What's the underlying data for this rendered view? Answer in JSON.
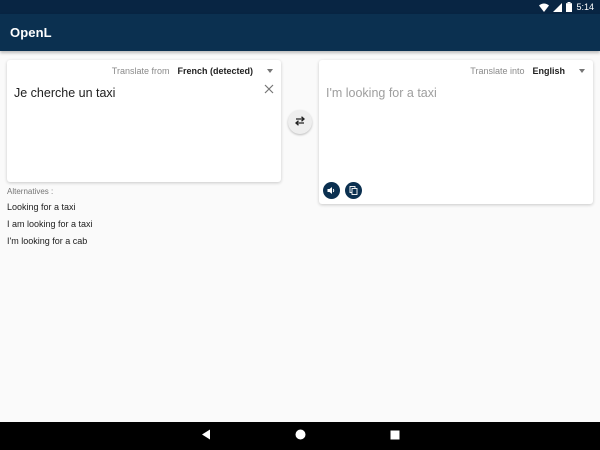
{
  "status_bar": {
    "time": "5:14"
  },
  "app_bar": {
    "title": "OpenL"
  },
  "source": {
    "caption": "Translate from",
    "language": "French (detected)",
    "text": "Je cherche un taxi"
  },
  "target": {
    "caption": "Translate into",
    "language": "English",
    "text": "I'm looking for a taxi"
  },
  "alternatives": {
    "caption": "Alternatives :",
    "items": [
      "Looking for a taxi",
      "I am looking for a taxi",
      "I'm looking for a cab"
    ]
  },
  "icons": {
    "clear": "close-icon",
    "swap": "swap-icon",
    "speak": "volume-icon",
    "copy": "copy-icon",
    "nav_back": "back-triangle-icon",
    "nav_home": "home-circle-icon",
    "nav_recents": "recents-square-icon"
  },
  "colors": {
    "app_bar": "#0b3050",
    "status_bar": "#082543",
    "background": "#fafafa",
    "accent_button": "#0b3050"
  }
}
